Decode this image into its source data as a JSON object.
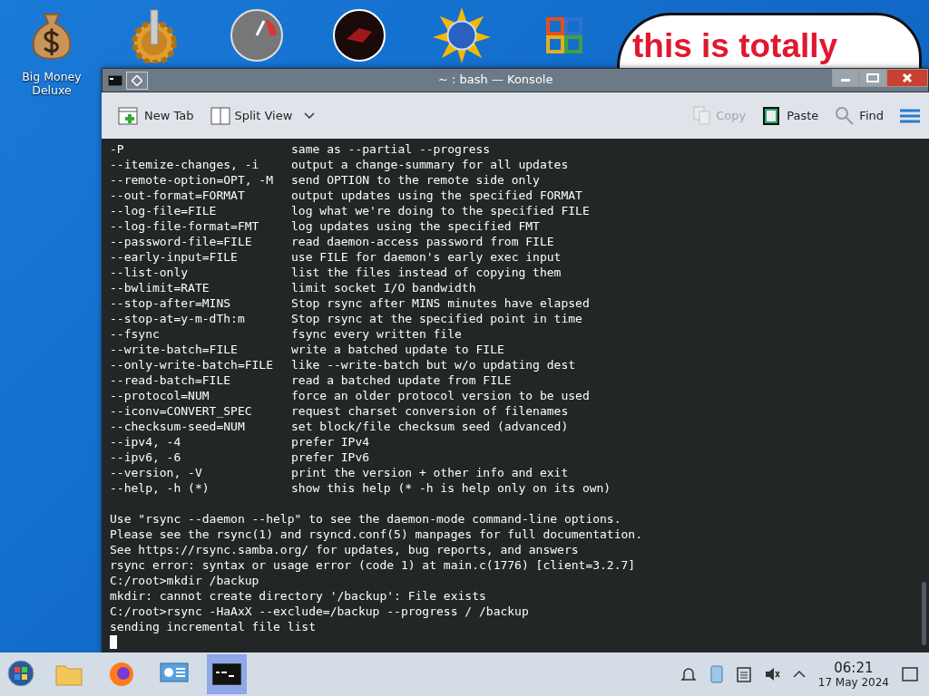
{
  "desktop": {
    "icons": [
      {
        "kind": "money",
        "label": "Big Money\nDeluxe"
      },
      {
        "kind": "gear"
      },
      {
        "kind": "gauge"
      },
      {
        "kind": "disc"
      },
      {
        "kind": "sun"
      },
      {
        "kind": "office"
      }
    ],
    "bubble": [
      "this is totally"
    ]
  },
  "window": {
    "title": "~ : bash — Konsole",
    "toolbar": [
      {
        "kind": "new-tab",
        "label": "New Tab",
        "disabled": false
      },
      {
        "kind": "split",
        "label": "Split View",
        "disabled": false
      },
      {
        "kind": "copy",
        "label": "Copy",
        "disabled": true
      },
      {
        "kind": "paste",
        "label": "Paste",
        "disabled": false
      },
      {
        "kind": "find",
        "label": "Find",
        "disabled": false
      }
    ],
    "terminal": {
      "options": [
        {
          "flag": "-P",
          "desc": "same as --partial --progress"
        },
        {
          "flag": "--itemize-changes, -i",
          "desc": "output a change-summary for all updates"
        },
        {
          "flag": "--remote-option=OPT, -M",
          "desc": "send OPTION to the remote side only"
        },
        {
          "flag": "--out-format=FORMAT",
          "desc": "output updates using the specified FORMAT"
        },
        {
          "flag": "--log-file=FILE",
          "desc": "log what we're doing to the specified FILE"
        },
        {
          "flag": "--log-file-format=FMT",
          "desc": "log updates using the specified FMT"
        },
        {
          "flag": "--password-file=FILE",
          "desc": "read daemon-access password from FILE"
        },
        {
          "flag": "--early-input=FILE",
          "desc": "use FILE for daemon's early exec input"
        },
        {
          "flag": "--list-only",
          "desc": "list the files instead of copying them"
        },
        {
          "flag": "--bwlimit=RATE",
          "desc": "limit socket I/O bandwidth"
        },
        {
          "flag": "--stop-after=MINS",
          "desc": "Stop rsync after MINS minutes have elapsed"
        },
        {
          "flag": "--stop-at=y-m-dTh:m",
          "desc": "Stop rsync at the specified point in time"
        },
        {
          "flag": "--fsync",
          "desc": "fsync every written file"
        },
        {
          "flag": "--write-batch=FILE",
          "desc": "write a batched update to FILE"
        },
        {
          "flag": "--only-write-batch=FILE",
          "desc": "like --write-batch but w/o updating dest"
        },
        {
          "flag": "--read-batch=FILE",
          "desc": "read a batched update from FILE"
        },
        {
          "flag": "--protocol=NUM",
          "desc": "force an older protocol version to be used"
        },
        {
          "flag": "--iconv=CONVERT_SPEC",
          "desc": "request charset conversion of filenames"
        },
        {
          "flag": "--checksum-seed=NUM",
          "desc": "set block/file checksum seed (advanced)"
        },
        {
          "flag": "--ipv4, -4",
          "desc": "prefer IPv4"
        },
        {
          "flag": "--ipv6, -6",
          "desc": "prefer IPv6"
        },
        {
          "flag": "--version, -V",
          "desc": "print the version + other info and exit"
        },
        {
          "flag": "--help, -h (*)",
          "desc": "show this help (* -h is help only on its own)"
        }
      ],
      "output": [
        "Use \"rsync --daemon --help\" to see the daemon-mode command-line options.",
        "Please see the rsync(1) and rsyncd.conf(5) manpages for full documentation.",
        "See https://rsync.samba.org/ for updates, bug reports, and answers",
        "rsync error: syntax or usage error (code 1) at main.c(1776) [client=3.2.7]",
        "C:/root>mkdir /backup",
        "mkdir: cannot create directory '/backup': File exists",
        "C:/root>rsync -HaAxX --exclude=/backup --progress / /backup",
        "sending incremental file list"
      ]
    }
  },
  "taskbar": {
    "apps": [
      {
        "kind": "folder",
        "active": false
      },
      {
        "kind": "browser",
        "active": false
      },
      {
        "kind": "settings",
        "active": false
      },
      {
        "kind": "terminal",
        "active": true
      }
    ],
    "clock": {
      "time": "06:21",
      "date": "17 May 2024"
    }
  }
}
